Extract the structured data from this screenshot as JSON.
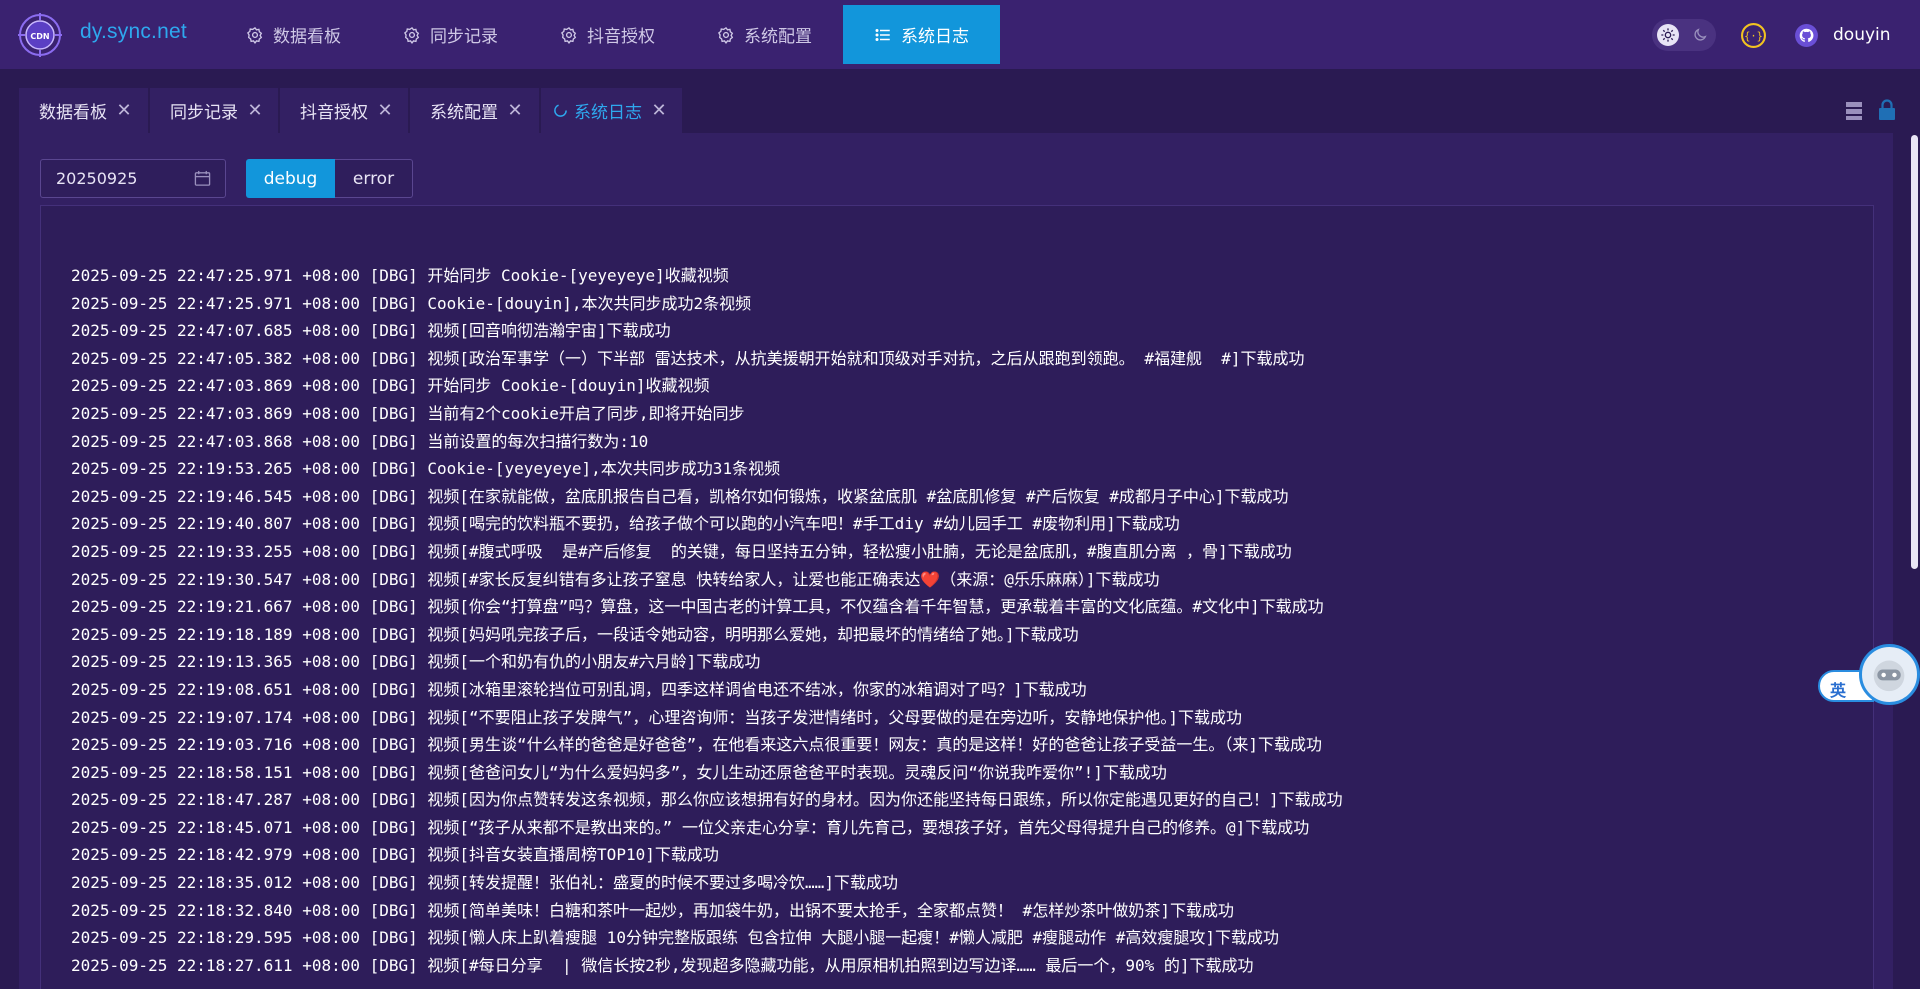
{
  "app": {
    "brand": "dy.sync.net",
    "logo_text": "CDN",
    "username": "douyin"
  },
  "nav": {
    "items": [
      {
        "label": "数据看板",
        "icon": "gear-icon",
        "active": false
      },
      {
        "label": "同步记录",
        "icon": "gear-icon",
        "active": false
      },
      {
        "label": "抖音授权",
        "icon": "gear-icon",
        "active": false
      },
      {
        "label": "系统配置",
        "icon": "gear-icon",
        "active": false
      },
      {
        "label": "系统日志",
        "icon": "list-icon",
        "active": true
      }
    ]
  },
  "tabs": [
    {
      "label": "数据看板",
      "active": false
    },
    {
      "label": "同步记录",
      "active": false
    },
    {
      "label": "抖音授权",
      "active": false
    },
    {
      "label": "系统配置",
      "active": false
    },
    {
      "label": "系统日志",
      "active": true
    }
  ],
  "filters": {
    "date_value": "20250925",
    "level_buttons": [
      {
        "label": "debug",
        "selected": true
      },
      {
        "label": "error",
        "selected": false
      }
    ]
  },
  "ime": {
    "label": "英"
  },
  "colors": {
    "accent": "#1296db",
    "topbar": "#3a2270",
    "background": "#2a1a52",
    "brand": "#2ea8ee"
  },
  "logs": [
    "2025-09-25 22:47:25.971 +08:00 [DBG] 开始同步 Cookie-[yeyeyeye]收藏视频",
    "2025-09-25 22:47:25.971 +08:00 [DBG] Cookie-[douyin],本次共同步成功2条视频",
    "2025-09-25 22:47:07.685 +08:00 [DBG] 视频[回音响彻浩瀚宇宙]下载成功",
    "2025-09-25 22:47:05.382 +08:00 [DBG] 视频[政治军事学（一）下半部 雷达技术，从抗美援朝开始就和顶级对手对抗，之后从跟跑到领跑。 #福建舰  #]下载成功",
    "2025-09-25 22:47:03.869 +08:00 [DBG] 开始同步 Cookie-[douyin]收藏视频",
    "2025-09-25 22:47:03.869 +08:00 [DBG] 当前有2个cookie开启了同步,即将开始同步",
    "2025-09-25 22:47:03.868 +08:00 [DBG] 当前设置的每次扫描行数为:10",
    "2025-09-25 22:19:53.265 +08:00 [DBG] Cookie-[yeyeyeye],本次共同步成功31条视频",
    "2025-09-25 22:19:46.545 +08:00 [DBG] 视频[在家就能做，盆底肌报告自己看，凯格尔如何锻炼，收紧盆底肌 #盆底肌修复 #产后恢复 #成都月子中心]下载成功",
    "2025-09-25 22:19:40.807 +08:00 [DBG] 视频[喝完的饮料瓶不要扔，给孩子做个可以跑的小汽车吧！#手工diy #幼儿园手工 #废物利用]下载成功",
    "2025-09-25 22:19:33.255 +08:00 [DBG] 视频[#腹式呼吸  是#产后修复  的关键，每日坚持五分钟，轻松瘦小肚腩，无论是盆底肌，#腹直肌分离 ，骨]下载成功",
    "2025-09-25 22:19:30.547 +08:00 [DBG] 视频[#家长反复纠错有多让孩子窒息 快转给家人，让爱也能正确表达❤️（来源：@乐乐麻麻）]下载成功",
    "2025-09-25 22:19:21.667 +08:00 [DBG] 视频[你会“打算盘”吗？算盘，这一中国古老的计算工具，不仅蕴含着千年智慧，更承载着丰富的文化底蕴。#文化中]下载成功",
    "2025-09-25 22:19:18.189 +08:00 [DBG] 视频[妈妈吼完孩子后，一段话令她动容，明明那么爱她，却把最坏的情绪给了她。]下载成功",
    "2025-09-25 22:19:13.365 +08:00 [DBG] 视频[一个和奶有仇的小朋友#六月龄]下载成功",
    "2025-09-25 22:19:08.651 +08:00 [DBG] 视频[冰箱里滚轮挡位可别乱调，四季这样调省电还不结冰，你家的冰箱调对了吗？]下载成功",
    "2025-09-25 22:19:07.174 +08:00 [DBG] 视频[“不要阻止孩子发脾气”，心理咨询师：当孩子发泄情绪时，父母要做的是在旁边听，安静地保护他。]下载成功",
    "2025-09-25 22:19:03.716 +08:00 [DBG] 视频[男生谈“什么样的爸爸是好爸爸”，在他看来这六点很重要！网友：真的是这样！好的爸爸让孩子受益一生。（来]下载成功",
    "2025-09-25 22:18:58.151 +08:00 [DBG] 视频[爸爸问女儿“为什么爱妈妈多”，女儿生动还原爸爸平时表现。灵魂反问“你说我咋爱你”!]下载成功",
    "2025-09-25 22:18:47.287 +08:00 [DBG] 视频[因为你点赞转发这条视频，那么你应该想拥有好的身材。因为你还能坚持每日跟练，所以你定能遇见更好的自己！]下载成功",
    "2025-09-25 22:18:45.071 +08:00 [DBG] 视频[“孩子从来都不是教出来的。” 一位父亲走心分享：育儿先育己，要想孩子好，首先父母得提升自己的修养。@]下载成功",
    "2025-09-25 22:18:42.979 +08:00 [DBG] 视频[抖音女装直播周榜TOP10]下载成功",
    "2025-09-25 22:18:35.012 +08:00 [DBG] 视频[转发提醒！张伯礼：盛夏的时候不要过多喝冷饮……]下载成功",
    "2025-09-25 22:18:32.840 +08:00 [DBG] 视频[简单美味！白糖和茶叶一起炒，再加袋牛奶，出锅不要太抢手，全家都点赞！ #怎样炒茶叶做奶茶]下载成功",
    "2025-09-25 22:18:29.595 +08:00 [DBG] 视频[懒人床上趴着瘦腿 10分钟完整版跟练 包含拉伸 大腿小腿一起瘦！#懒人减肥 #瘦腿动作 #高效瘦腿攻]下载成功",
    "2025-09-25 22:18:27.611 +08:00 [DBG] 视频[#每日分享  | 微信长按2秒,发现超多隐藏功能，从用原相机拍照到边写边译…… 最后一个，90% 的]下载成功"
  ]
}
